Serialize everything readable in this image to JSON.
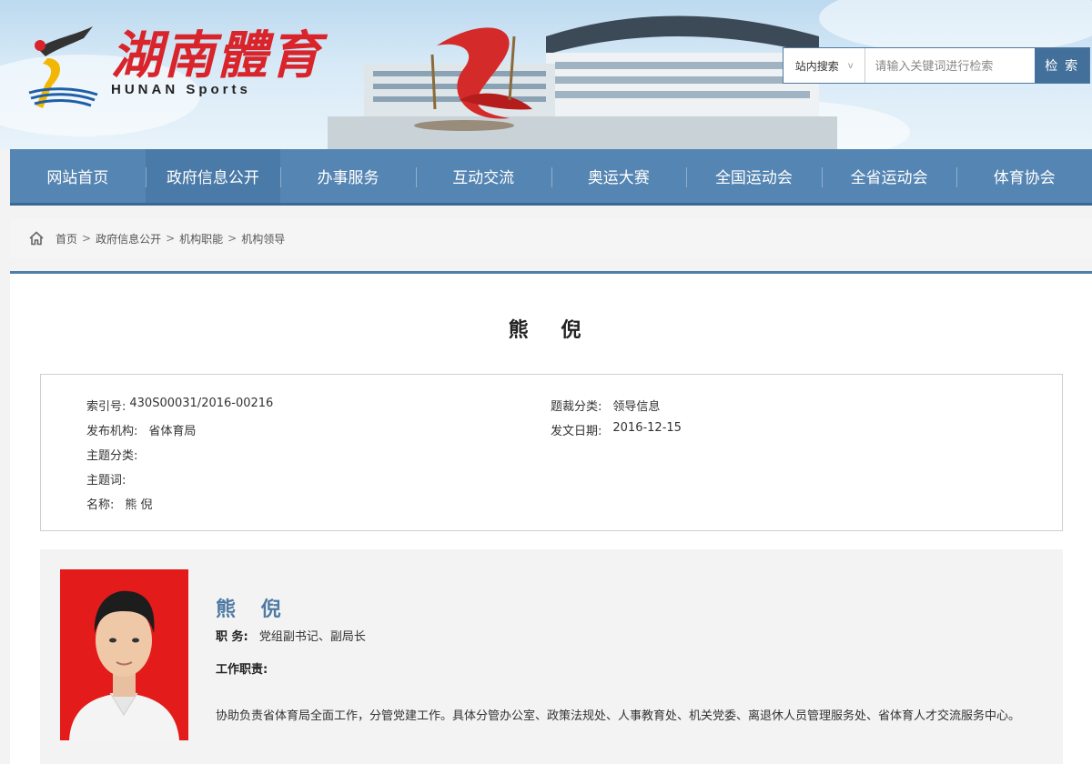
{
  "header": {
    "logo_cn": "湖南體育",
    "logo_en": "HUNAN Sports",
    "search": {
      "scope_label": "站内搜索",
      "placeholder": "请输入关键词进行检索",
      "button_label": "检 索"
    }
  },
  "nav": {
    "items": [
      "网站首页",
      "政府信息公开",
      "办事服务",
      "互动交流",
      "奥运大赛",
      "全国运动会",
      "全省运动会",
      "体育协会"
    ],
    "active_index": 1
  },
  "breadcrumb": {
    "items": [
      "首页",
      "政府信息公开",
      "机构职能",
      "机构领导"
    ],
    "separator": ">"
  },
  "article": {
    "title": "熊 倪",
    "meta": {
      "index_label": "索引号:",
      "index_value": "430S00031/2016-00216",
      "genre_label": "题裁分类:",
      "genre_value": "领导信息",
      "publisher_label": "发布机构:",
      "publisher_value": "省体育局",
      "date_label": "发文日期:",
      "date_value": "2016-12-15",
      "topic_label": "主题分类:",
      "keywords_label": "主题词:",
      "name_label": "名称:",
      "name_value": "熊 倪"
    }
  },
  "profile": {
    "name": "熊 倪",
    "position_label": "职 务:",
    "position_value": "党组副书记、副局长",
    "duties_label": "工作职责:",
    "duties_text": "协助负责省体育局全面工作，分管党建工作。具体分管办公室、政策法规处、人事教育处、机关党委、离退休人员管理服务处、省体育人才交流服务中心。"
  },
  "colors": {
    "nav_bg": "#5585b2",
    "accent_blue": "#4f7aa3",
    "logo_red": "#d8242a",
    "photo_bg": "#e41b1b"
  }
}
